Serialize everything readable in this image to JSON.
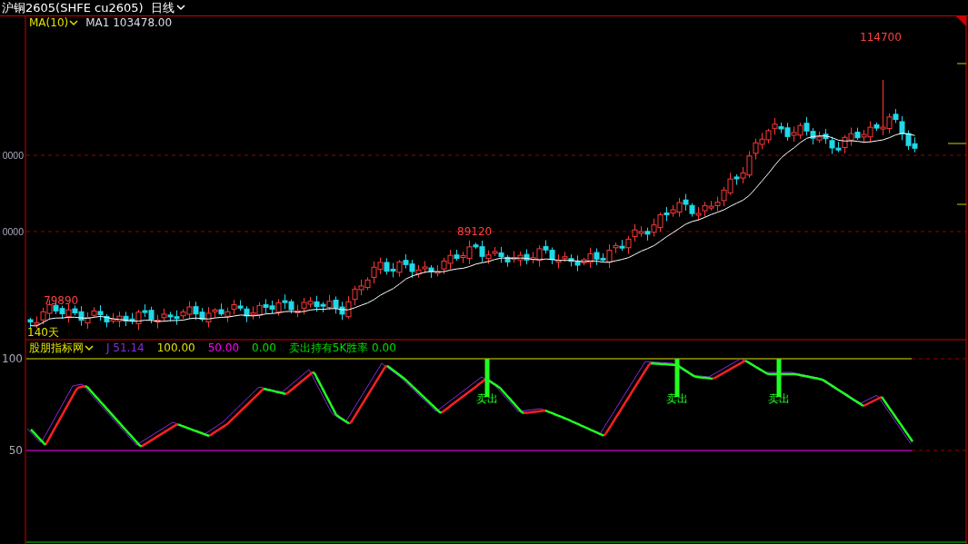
{
  "title_bar": {
    "instrument": "沪铜2605(SHFE cu2605)",
    "period": "日线"
  },
  "price_panel": {
    "indicator": "MA(10)",
    "ma_reading": "MA1 103478.00",
    "y_axis_labels": [
      "0000",
      "0000"
    ],
    "price_labels": [
      {
        "text": "114700"
      },
      {
        "text": "89120"
      },
      {
        "text": "79890"
      }
    ],
    "range_label": "140天"
  },
  "indicator_panel": {
    "name": "股朋指标网",
    "readings": [
      {
        "text": "J 51.14",
        "color": "#8a2be2"
      },
      {
        "text": "100.00",
        "color": "#e0e000"
      },
      {
        "text": "50.00",
        "color": "#ff00ff"
      },
      {
        "text": "0.00",
        "color": "#00e000"
      },
      {
        "text": "卖出持有5K胜率 0.00",
        "color": "#00e000"
      }
    ],
    "y_axis_labels": [
      "100",
      "50"
    ],
    "signals": [
      "卖出",
      "卖出",
      "卖出"
    ]
  }
}
